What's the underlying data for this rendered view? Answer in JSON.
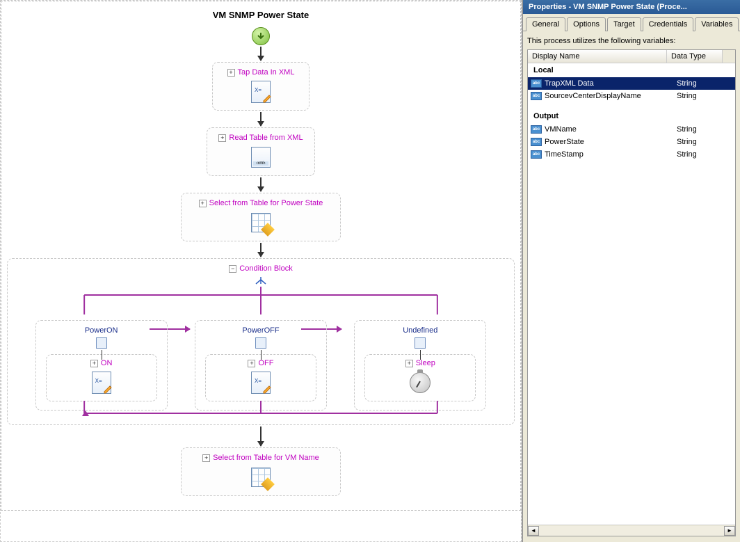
{
  "process": {
    "title": "VM SNMP Power State",
    "activities": {
      "a1": "Tap Data In XML",
      "a2": "Read Table from XML",
      "a3": "Select from Table for Power State",
      "condition": "Condition Block",
      "a4": "Select from Table for VM Name"
    },
    "branches": [
      {
        "title": "PowerON",
        "sub": "ON"
      },
      {
        "title": "PowerOFF",
        "sub": "OFF"
      },
      {
        "title": "Undefined",
        "sub": "Sleep"
      }
    ]
  },
  "panel": {
    "title": "Properties - VM SNMP Power State (Proce...",
    "tabs": [
      "General",
      "Options",
      "Target",
      "Credentials",
      "Variables"
    ],
    "active_tab": "Variables",
    "intro": "This process utilizes the following variables:",
    "columns": {
      "name": "Display Name",
      "type": "Data Type"
    },
    "sections": [
      {
        "heading": "Local",
        "rows": [
          {
            "name": "TrapXML Data",
            "type": "String",
            "selected": true
          },
          {
            "name": "SourcevCenterDisplayName",
            "type": "String",
            "selected": false
          }
        ]
      },
      {
        "heading": "Output",
        "rows": [
          {
            "name": "VMName",
            "type": "String",
            "selected": false
          },
          {
            "name": "PowerState",
            "type": "String",
            "selected": false
          },
          {
            "name": "TimeStamp",
            "type": "String",
            "selected": false
          }
        ]
      }
    ]
  }
}
